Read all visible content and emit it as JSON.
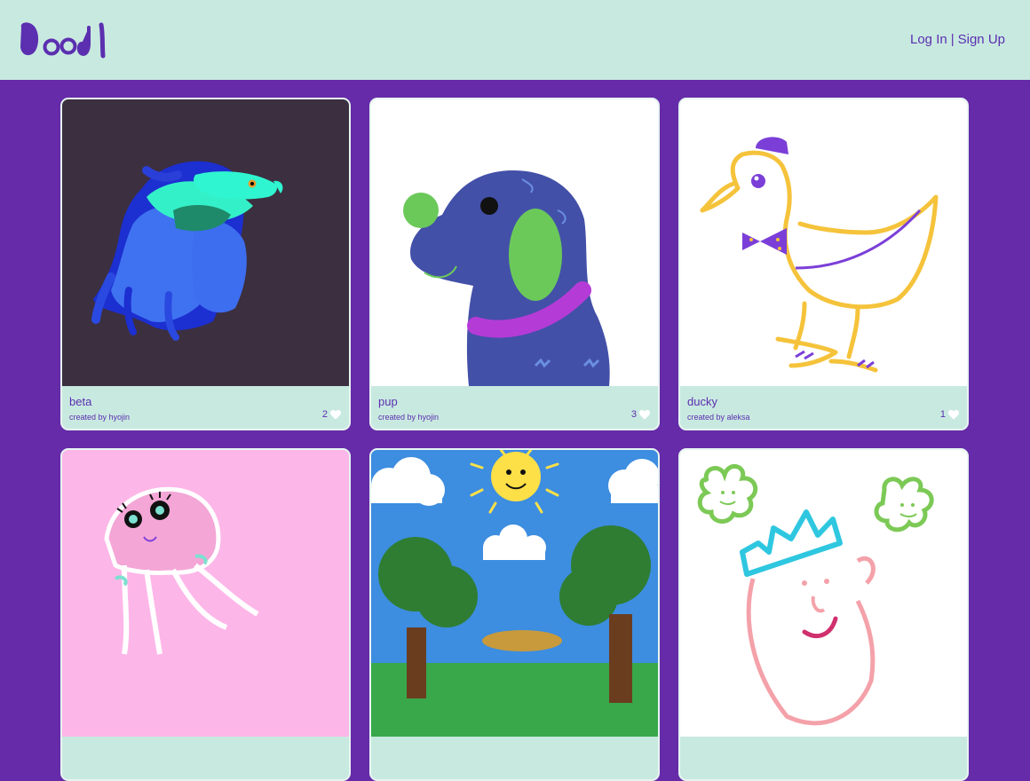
{
  "header": {
    "logo_text": "Doodl",
    "login_label": "Log In",
    "separator": "|",
    "signup_label": "Sign Up"
  },
  "cards": [
    {
      "title": "beta",
      "creator": "created by hyojin",
      "likes": "2"
    },
    {
      "title": "pup",
      "creator": "created by hyojin",
      "likes": "3"
    },
    {
      "title": "ducky",
      "creator": "created by aleksa",
      "likes": "1"
    },
    {
      "title": "",
      "creator": "",
      "likes": ""
    },
    {
      "title": "",
      "creator": "",
      "likes": ""
    },
    {
      "title": "",
      "creator": "",
      "likes": ""
    }
  ],
  "colors": {
    "background": "#652ba8",
    "header": "#c8e9e0",
    "accent_text": "#5b2fb0"
  }
}
